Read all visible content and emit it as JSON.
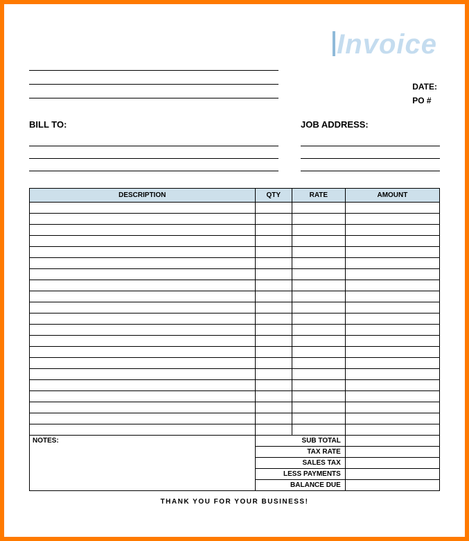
{
  "title": "Invoice",
  "meta": {
    "date_label": "DATE:",
    "po_label": "PO #"
  },
  "labels": {
    "bill_to": "BILL TO:",
    "job_address": "JOB ADDRESS:"
  },
  "columns": {
    "description": "DESCRIPTION",
    "qty": "QTY",
    "rate": "RATE",
    "amount": "AMOUNT"
  },
  "notes_label": "NOTES:",
  "totals": {
    "subtotal": "SUB TOTAL",
    "tax_rate": "TAX RATE",
    "sales_tax": "SALES TAX",
    "less_payments": "LESS PAYMENTS",
    "balance_due": "BALANCE DUE"
  },
  "footer": "THANK YOU FOR YOUR BUSINESS!"
}
